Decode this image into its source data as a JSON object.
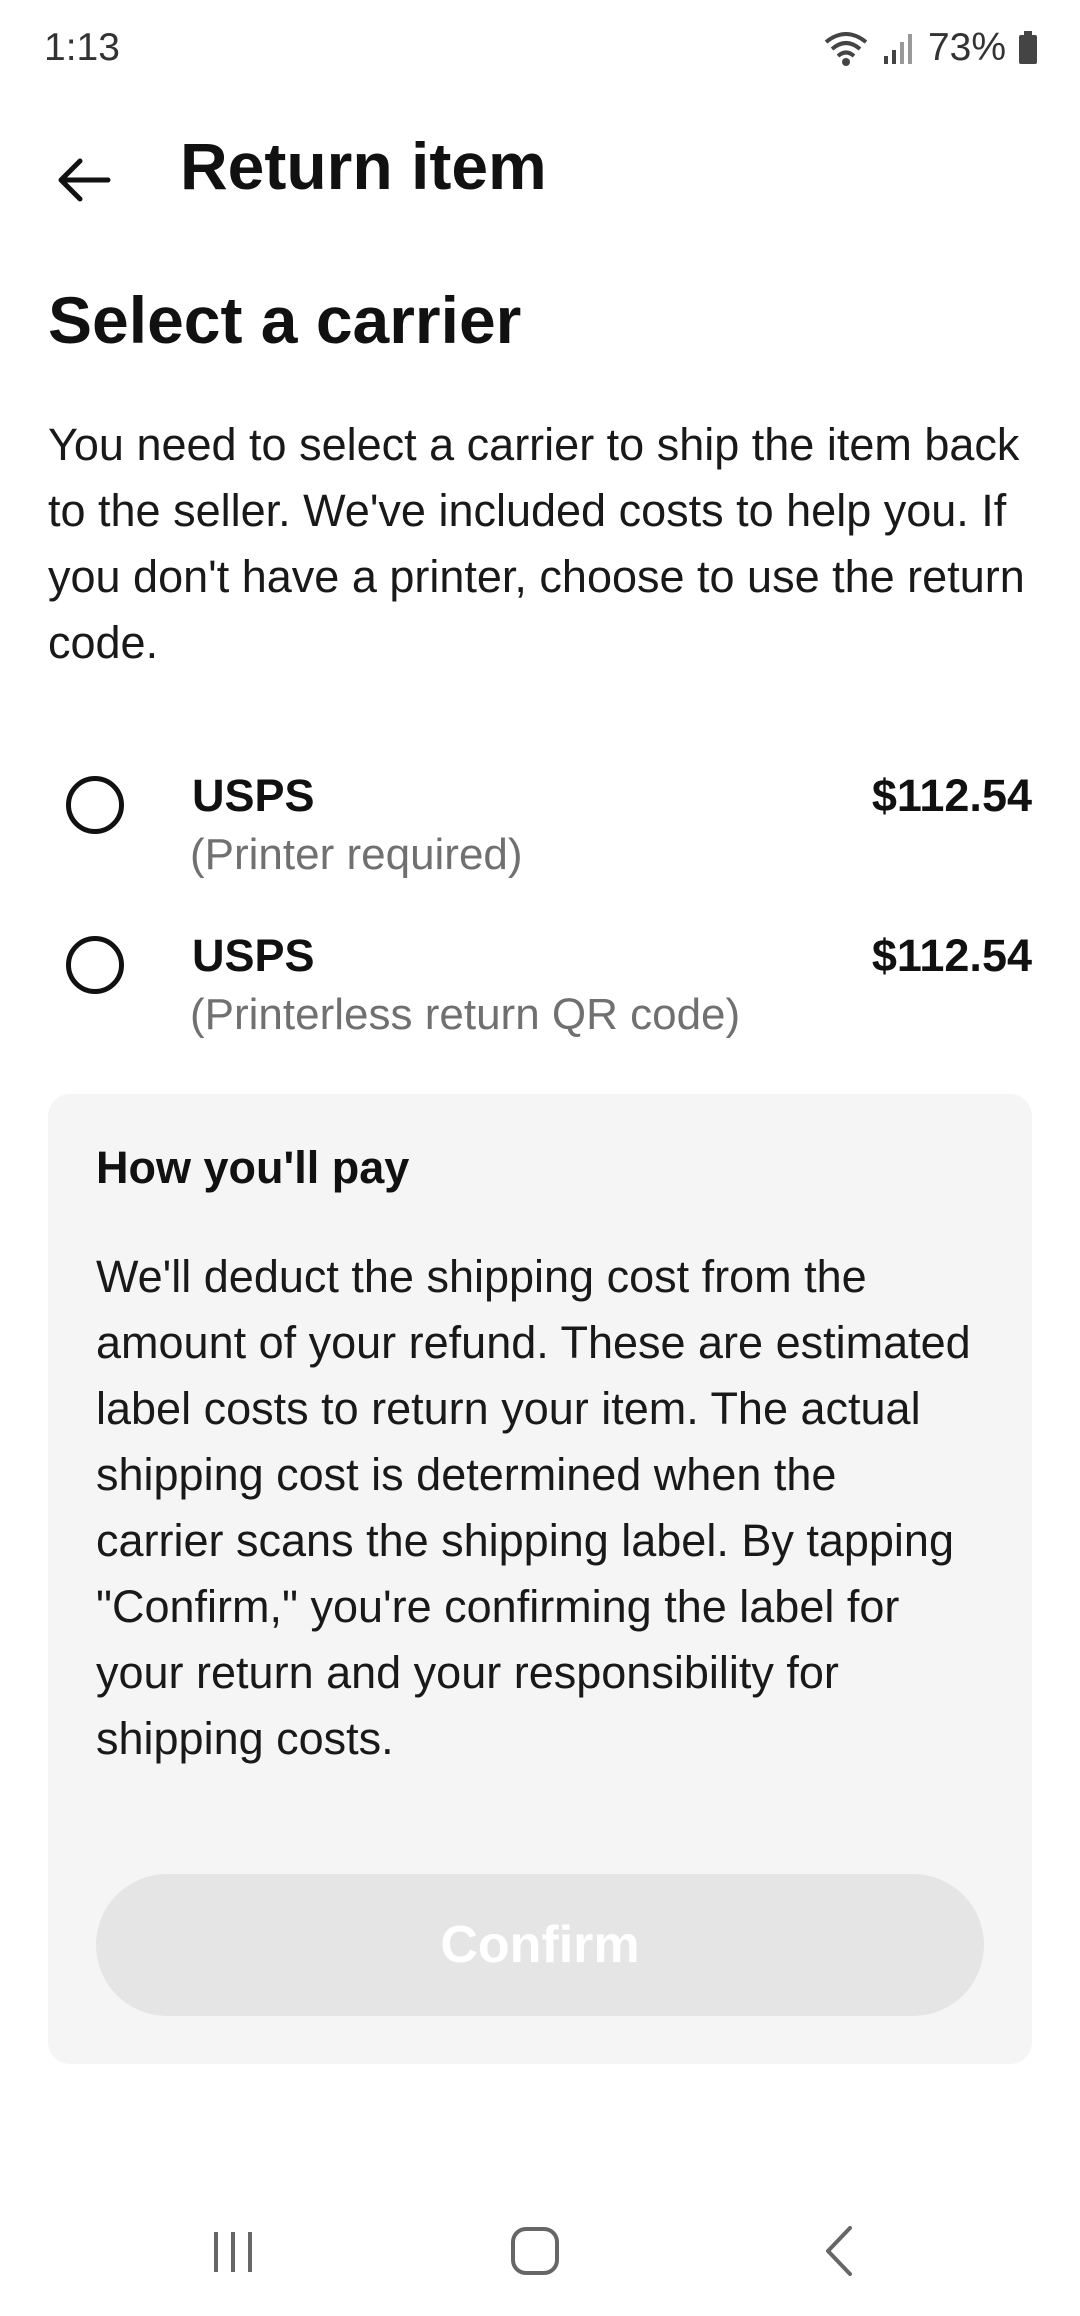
{
  "status_bar": {
    "time": "1:13",
    "battery": "73%"
  },
  "header": {
    "title": "Return item",
    "back_icon": "arrow-left-icon"
  },
  "section": {
    "title": "Select a carrier",
    "description": "You need to select a carrier to ship the item back to the seller. We've included costs to help you. If you don't have a printer, choose to use the return code."
  },
  "carriers": [
    {
      "name": "USPS",
      "note": "(Printer required)",
      "price": "$112.54",
      "selected": false
    },
    {
      "name": "USPS",
      "note": "(Printerless return QR code)",
      "price": "$112.54",
      "selected": false
    }
  ],
  "payment": {
    "title": "How you'll pay",
    "text": "We'll deduct the shipping cost from the amount of your refund. These are estimated label costs to return your item. The actual shipping cost is determined when the carrier scans the shipping label. By tapping \"Confirm,\" you're confirming the label for your return and your responsibility for shipping costs.",
    "confirm_label": "Confirm",
    "confirm_enabled": false
  },
  "colors": {
    "text": "#191919",
    "muted": "#707070",
    "card_bg": "#f5f5f5",
    "button_disabled": "#e5e5e5"
  },
  "nav_icons": [
    "recent-apps-icon",
    "home-icon",
    "back-nav-icon"
  ]
}
